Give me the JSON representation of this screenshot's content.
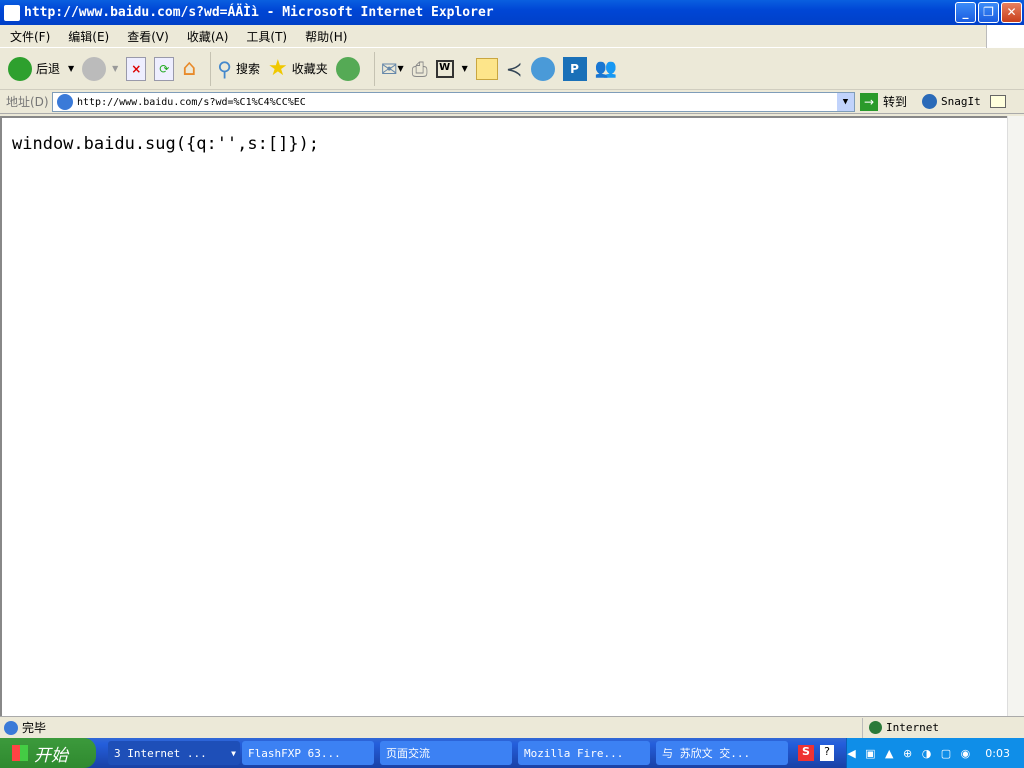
{
  "window": {
    "title": "http://www.baidu.com/s?wd=ÁÄÌì - Microsoft Internet Explorer",
    "minimize": "_",
    "restore": "❐",
    "close": "✕"
  },
  "menu": [
    "文件(F)",
    "编辑(E)",
    "查看(V)",
    "收藏(A)",
    "工具(T)",
    "帮助(H)"
  ],
  "toolbar": {
    "back": "后退",
    "search": "搜索",
    "favorites": "收藏夹"
  },
  "address": {
    "label": "地址(D)",
    "url": "http://www.baidu.com/s?wd=%C1%C4%CC%EC",
    "go": "转到",
    "snagit": "SnagIt"
  },
  "content": {
    "text": "window.baidu.sug({q:'',s:[]});"
  },
  "status": {
    "text": "完毕",
    "zone": "Internet"
  },
  "taskbar": {
    "start": "开始",
    "tasks": [
      "3 Internet ...",
      "FlashFXP 63...",
      "页面交流",
      "Mozilla Fire...",
      "与 苏欣文 交..."
    ],
    "clock": "0:03"
  }
}
